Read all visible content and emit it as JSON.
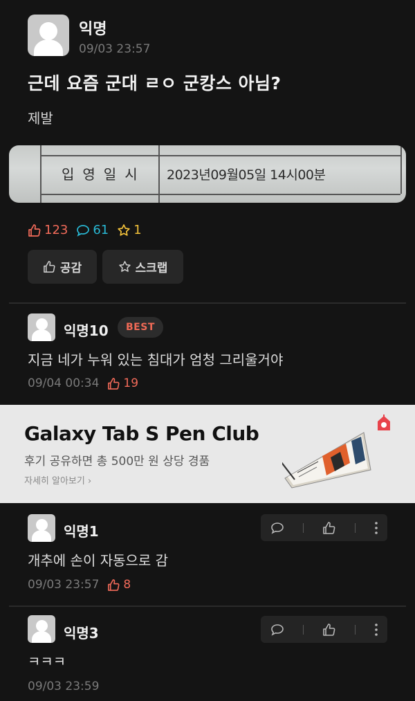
{
  "post": {
    "author": "익명",
    "time": "09/03 23:57",
    "title": "근데 요즘 군대 ㄹㅇ 군캉스 아님?",
    "body": "제발",
    "photo": {
      "label": "입영일시",
      "value": "2023년09월05일 14시00분"
    },
    "stats": {
      "likes": "123",
      "comments": "61",
      "scraps": "1"
    },
    "actions": {
      "like_label": "공감",
      "scrap_label": "스크랩"
    }
  },
  "comments": [
    {
      "author": "익명10",
      "badge": "BEST",
      "text": "지금 네가 누워 있는 침대가 엄청 그리울거야",
      "time": "09/04 00:34",
      "likes": "19"
    },
    {
      "author": "익명1",
      "text": "개추에 손이 자동으로 감",
      "time": "09/03 23:57",
      "likes": "8"
    },
    {
      "author": "익명3",
      "text": "ㅋㅋㅋ",
      "time": "09/03 23:59"
    }
  ],
  "ad": {
    "title": "Galaxy Tab S Pen Club",
    "subtitle": "후기 공유하면 총 500만 원 상당 경품",
    "more_link": "자세히 알아보기 ›"
  },
  "colors": {
    "background": "#141414",
    "like": "#f36b5a",
    "comment": "#29b8d4",
    "scrap": "#f2c13a",
    "best": "#f06a56"
  },
  "icons": [
    "thumb-up-icon",
    "speech-bubble-icon",
    "star-icon",
    "more-vertical-icon",
    "avatar-icon"
  ]
}
